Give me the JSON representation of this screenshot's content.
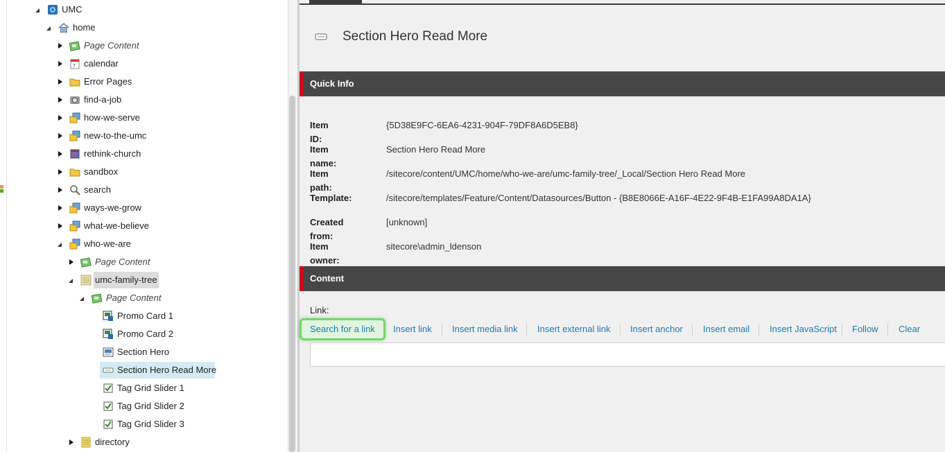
{
  "tree": {
    "root": "UMC",
    "home": "home",
    "home_children": [
      {
        "label": "Page Content",
        "italic": true,
        "icon": "page-content-icon"
      },
      {
        "label": "calendar",
        "icon": "calendar-icon"
      },
      {
        "label": "Error Pages",
        "icon": "folder-icon"
      },
      {
        "label": "find-a-job",
        "icon": "camera-icon"
      },
      {
        "label": "how-we-serve",
        "icon": "page-folder-icon"
      },
      {
        "label": "new-to-the-umc",
        "icon": "page-folder-icon"
      },
      {
        "label": "rethink-church",
        "icon": "gradient-page-icon"
      },
      {
        "label": "sandbox",
        "icon": "folder-icon"
      },
      {
        "label": "search",
        "icon": "search-icon"
      },
      {
        "label": "ways-we-grow",
        "icon": "page-folder-icon"
      },
      {
        "label": "what-we-believe",
        "icon": "page-folder-icon"
      },
      {
        "label": "who-we-are",
        "icon": "page-folder-icon"
      }
    ],
    "who_we_are_children": {
      "page_content": "Page Content",
      "umc_family_tree": "umc-family-tree",
      "ft_page_content": "Page Content",
      "local_items": [
        "Promo Card 1",
        "Promo Card 2",
        "Section Hero",
        "Section Hero Read More",
        "Tag Grid Slider 1",
        "Tag Grid Slider 2",
        "Tag Grid Slider 3"
      ],
      "directory": "directory"
    }
  },
  "item": {
    "title": "Section Hero Read More"
  },
  "quick_info": {
    "heading": "Quick Info",
    "rows": [
      {
        "key": "Item ID:",
        "value": "{5D38E9FC-6EA6-4231-904F-79DF8A6D5EB8}"
      },
      {
        "key": "Item name:",
        "value": "Section Hero Read More"
      },
      {
        "key": "Item path:",
        "value": "/sitecore/content/UMC/home/who-we-are/umc-family-tree/_Local/Section Hero Read More"
      },
      {
        "key": "Template:",
        "value": "/sitecore/templates/Feature/Content/Datasources/Button - {B8E8066E-A16F-4E22-9F4B-E1FA99A8DA1A}"
      },
      {
        "key": "Created from:",
        "value": "[unknown]"
      },
      {
        "key": "Item owner:",
        "value": "sitecore\\admin_ldenson"
      }
    ]
  },
  "content_section": {
    "heading": "Content",
    "link_label": "Link:",
    "actions": [
      "Search for a link",
      "Insert link",
      "Insert media link",
      "Insert external link",
      "Insert anchor",
      "Insert email",
      "Insert JavaScript",
      "Follow",
      "Clear"
    ],
    "link_value": ""
  },
  "colors": {
    "section_header": "#474747",
    "section_accent": "#d0021b",
    "link": "#1a7bb0",
    "highlight_ring": "#78d56f",
    "selected_row": "#d4eaf5"
  }
}
